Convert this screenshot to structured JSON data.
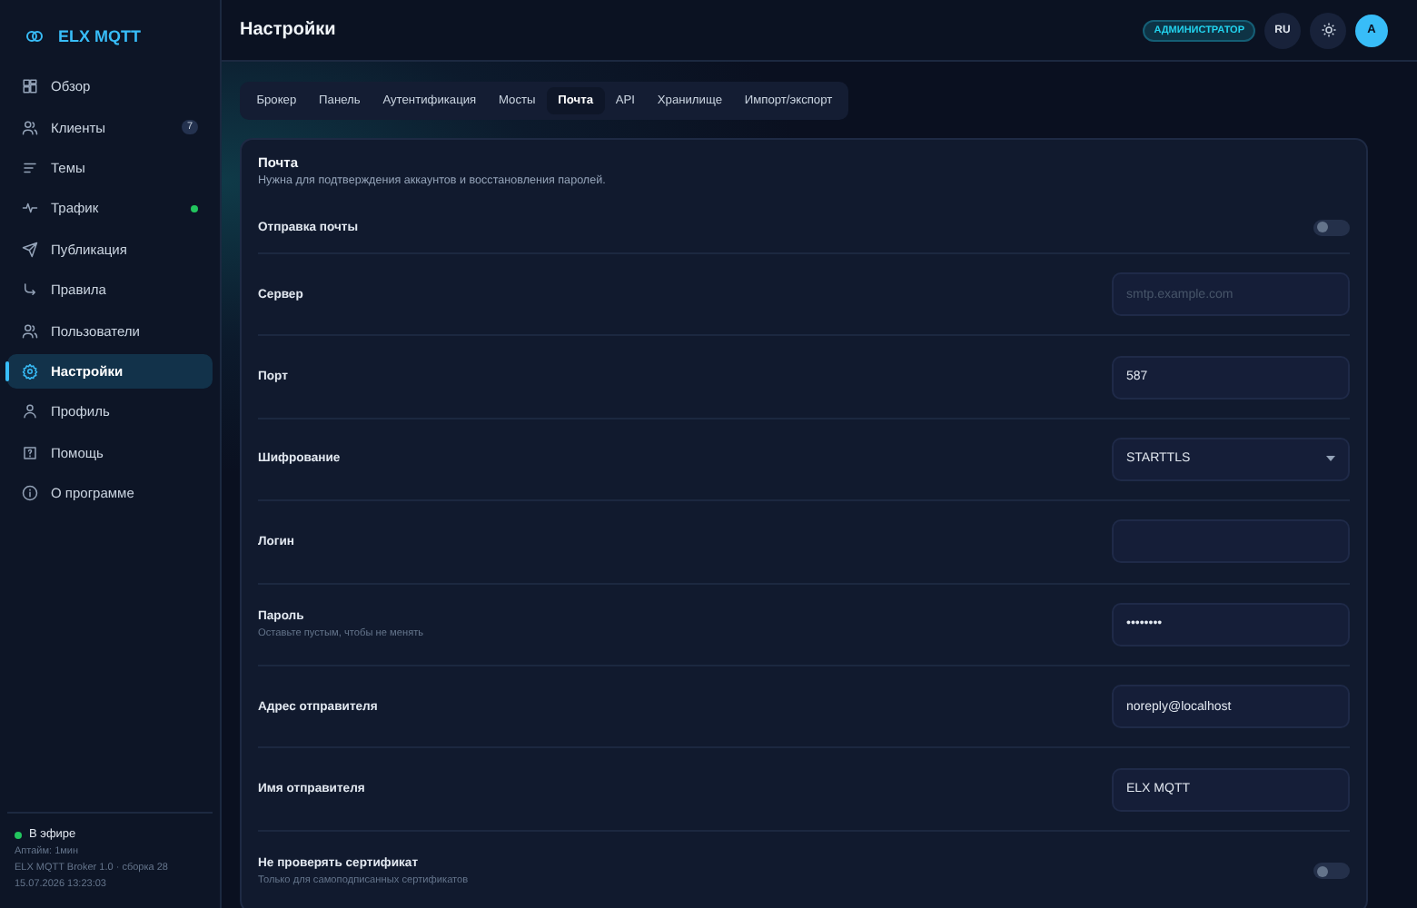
{
  "sidebar": {
    "logo": "ELX MQTT",
    "items": [
      {
        "label": "Обзор",
        "selected": false
      },
      {
        "label": "Клиенты",
        "selected": false,
        "badge": "7"
      },
      {
        "label": "Темы",
        "selected": false
      },
      {
        "label": "Трафик",
        "selected": false,
        "color": "#22c55e"
      },
      {
        "label": "Публикация",
        "selected": false
      },
      {
        "label": "Правила",
        "selected": false
      },
      {
        "label": "Пользователи",
        "selected": false
      },
      {
        "label": "Настройки",
        "selected": true
      },
      {
        "label": "Профиль",
        "selected": false
      },
      {
        "label": "Помощь",
        "selected": false
      },
      {
        "label": "О программе",
        "selected": false
      }
    ],
    "status": {
      "label": "В эфире",
      "color": "#22c55e",
      "lines": [
        "Аптайм: 1мин",
        "ELX MQTT Broker 1.0 · сборка 28",
        "15.07.2026 13:23:03"
      ]
    }
  },
  "header": {
    "title": "Настройки",
    "role_badge": "АДМИНИСТРАТОР",
    "language": "RU",
    "avatar": "A"
  },
  "tabs": [
    {
      "label": "Брокер",
      "selected": false
    },
    {
      "label": "Панель",
      "selected": false
    },
    {
      "label": "Аутентификация",
      "selected": false
    },
    {
      "label": "Мосты",
      "selected": false
    },
    {
      "label": "Почта",
      "selected": true
    },
    {
      "label": "API",
      "selected": false
    },
    {
      "label": "Хранилище",
      "selected": false
    },
    {
      "label": "Импорт/экспорт",
      "selected": false
    }
  ],
  "section": {
    "title": "Почта",
    "description": "Нужна для подтверждения аккаунтов и восстановления паролей.",
    "rows": [
      {
        "kind": "toggle",
        "label": "Отправка почты",
        "on": false
      },
      {
        "kind": "text",
        "label": "Сервер",
        "placeholder": "smtp.example.com"
      },
      {
        "kind": "text",
        "label": "Порт",
        "value": "587"
      },
      {
        "kind": "select",
        "label": "Шифрование",
        "value": "STARTTLS"
      },
      {
        "kind": "text",
        "label": "Логин"
      },
      {
        "kind": "text",
        "label": "Пароль",
        "hint": "Оставьте пустым, чтобы не менять",
        "value": "••••••••"
      },
      {
        "kind": "text",
        "label": "Адрес отправителя",
        "value": "noreply@localhost"
      },
      {
        "kind": "text",
        "label": "Имя отправителя",
        "value": "ELX MQTT"
      },
      {
        "kind": "toggle",
        "label": "Не проверять сертификат",
        "hint": "Только для самоподписанных сертификатов",
        "on": false
      }
    ]
  }
}
